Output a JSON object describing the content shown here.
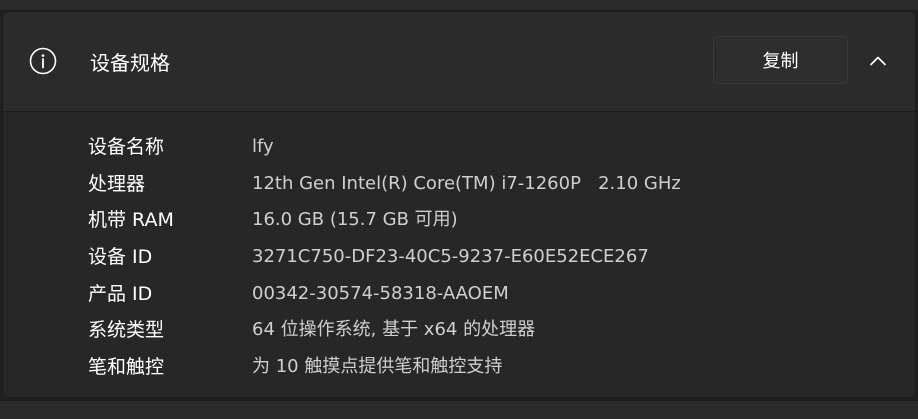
{
  "section": {
    "title": "设备规格",
    "copy_label": "复制",
    "info_icon": "info-icon",
    "toggle_icon": "chevron-up-icon"
  },
  "specs": [
    {
      "label": "设备名称",
      "value": "lfy"
    },
    {
      "label": "处理器",
      "value": "12th Gen Intel(R) Core(TM) i7-1260P   2.10 GHz"
    },
    {
      "label": "机带 RAM",
      "value": "16.0 GB (15.7 GB 可用)"
    },
    {
      "label": "设备 ID",
      "value": "3271C750-DF23-40C5-9237-E60E52ECE267"
    },
    {
      "label": "产品 ID",
      "value": "00342-30574-58318-AAOEM"
    },
    {
      "label": "系统类型",
      "value": "64 位操作系统, 基于 x64 的处理器"
    },
    {
      "label": "笔和触控",
      "value": "为 10 触摸点提供笔和触控支持"
    }
  ],
  "colors": {
    "background": "#202020",
    "header": "#2b2b2b",
    "body": "#272727",
    "value_text": "#cfcfcf"
  }
}
